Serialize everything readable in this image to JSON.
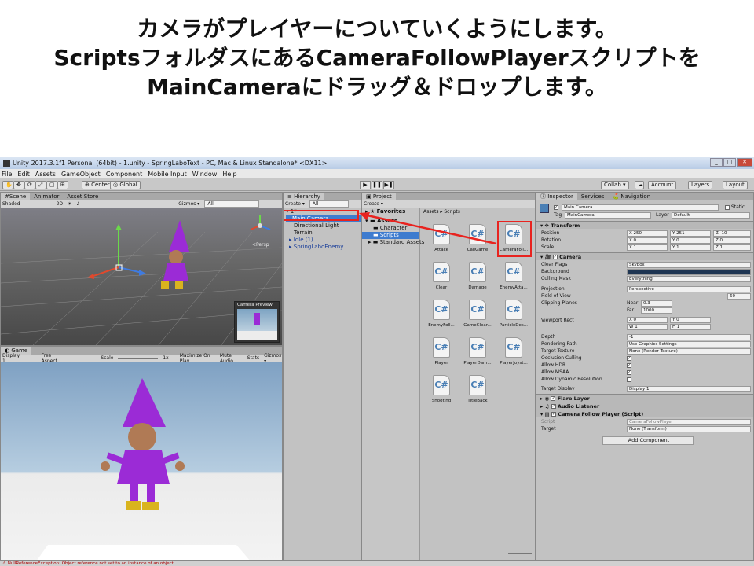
{
  "caption": {
    "line1": "カメラがプレイヤーについていくようにします。",
    "line2": "ScriptsフォルダスにあるCameraFollowPlayerスクリプトを",
    "line3": "MainCameraにドラッグ＆ドロップします。"
  },
  "window": {
    "title": "Unity 2017.3.1f1 Personal (64bit) - 1.unity - SpringLaboText - PC, Mac & Linux Standalone* <DX11>",
    "buttons": [
      "_",
      "□",
      "✕"
    ]
  },
  "menu": [
    "File",
    "Edit",
    "Assets",
    "GameObject",
    "Component",
    "Mobile Input",
    "Window",
    "Help"
  ],
  "toolbar": {
    "center": "Center",
    "global": "Global",
    "collab": "Collab ▾",
    "account": "Account",
    "layers": "Layers",
    "layout": "Layout"
  },
  "scene": {
    "tabs": [
      "Scene",
      "Animator",
      "Asset Store"
    ],
    "shading": "Shaded",
    "mode2d": "2D",
    "gizmos": "Gizmos ▾",
    "search": "All",
    "persp": "<Persp",
    "camera_preview": "Camera Preview"
  },
  "game": {
    "tab": "Game",
    "display": "Display 1",
    "aspect": "Free Aspect",
    "scale_label": "Scale",
    "scale_value": "1x",
    "options": [
      "Maximize On Play",
      "Mute Audio",
      "Stats",
      "Gizmos ▾"
    ]
  },
  "hierarchy": {
    "tab": "Hierarchy",
    "create": "Create ▾",
    "search": "All",
    "scene_name": "1*",
    "items": [
      "Main Camera",
      "Directional Light",
      "Terrain",
      "Idle (1)",
      "SpringLaboEnemy"
    ]
  },
  "project": {
    "tab": "Project",
    "create": "Create ▾",
    "favorites": "Favorites",
    "assets": "Assets",
    "folders": [
      "Character",
      "Scripts",
      "Standard Assets"
    ],
    "breadcrumb": "Assets ▸ Scripts",
    "scripts": [
      "Attack",
      "CallGame",
      "CameraFoll...",
      "Clear",
      "Damage",
      "EnemyAtta...",
      "EnemyFoll...",
      "GameClear...",
      "ParticleDes...",
      "Player",
      "PlayerDam...",
      "PlayerJoyst...",
      "Shooting",
      "TitleBack"
    ],
    "cs_glyph": "C#"
  },
  "inspector": {
    "tabs": [
      "Inspector",
      "Services",
      "Navigation"
    ],
    "object_name": "Main Camera",
    "static": "Static",
    "tag_label": "Tag",
    "tag_value": "MainCamera",
    "layer_label": "Layer",
    "layer_value": "Default",
    "transform": {
      "title": "Transform",
      "position": {
        "label": "Position",
        "x": "250",
        "y": "251",
        "z": "-10"
      },
      "rotation": {
        "label": "Rotation",
        "x": "0",
        "y": "0",
        "z": "0"
      },
      "scale": {
        "label": "Scale",
        "x": "1",
        "y": "1",
        "z": "1"
      }
    },
    "camera": {
      "title": "Camera",
      "rows": [
        {
          "label": "Clear Flags",
          "value": "Skybox"
        },
        {
          "label": "Background",
          "value": ""
        },
        {
          "label": "Culling Mask",
          "value": "Everything"
        },
        {
          "label": "Projection",
          "value": "Perspective"
        },
        {
          "label": "Field of View",
          "value": "60"
        },
        {
          "label": "Clipping Planes",
          "value": ""
        },
        {
          "label": "Viewport Rect",
          "value": ""
        },
        {
          "label": "Depth",
          "value": "-1"
        },
        {
          "label": "Rendering Path",
          "value": "Use Graphics Settings"
        },
        {
          "label": "Target Texture",
          "value": "None (Render Texture)"
        },
        {
          "label": "Occlusion Culling",
          "value": ""
        },
        {
          "label": "Allow HDR",
          "value": ""
        },
        {
          "label": "Allow MSAA",
          "value": ""
        },
        {
          "label": "Allow Dynamic Resolution",
          "value": ""
        },
        {
          "label": "Target Display",
          "value": "Display 1"
        }
      ],
      "near_label": "Near",
      "near_value": "0.3",
      "far_label": "Far",
      "far_value": "1000",
      "vx": "0",
      "vy": "0",
      "vw": "1",
      "vh": "1",
      "background_color": "#1e3552"
    },
    "components": [
      "Flare Layer",
      "Audio Listener",
      "Camera Follow Player (Script)"
    ],
    "script_label": "Script",
    "script_value": "CameraFollowPlayer",
    "target_label": "Target",
    "target_value": "None (Transform)",
    "add_component": "Add Component"
  },
  "console_error": "NullReferenceException: Object reference not set to an instance of an object",
  "colors": {
    "highlight_red": "#e8231f",
    "selected_blue": "#3e7ccf",
    "character_purple": "#9b2bd6"
  }
}
